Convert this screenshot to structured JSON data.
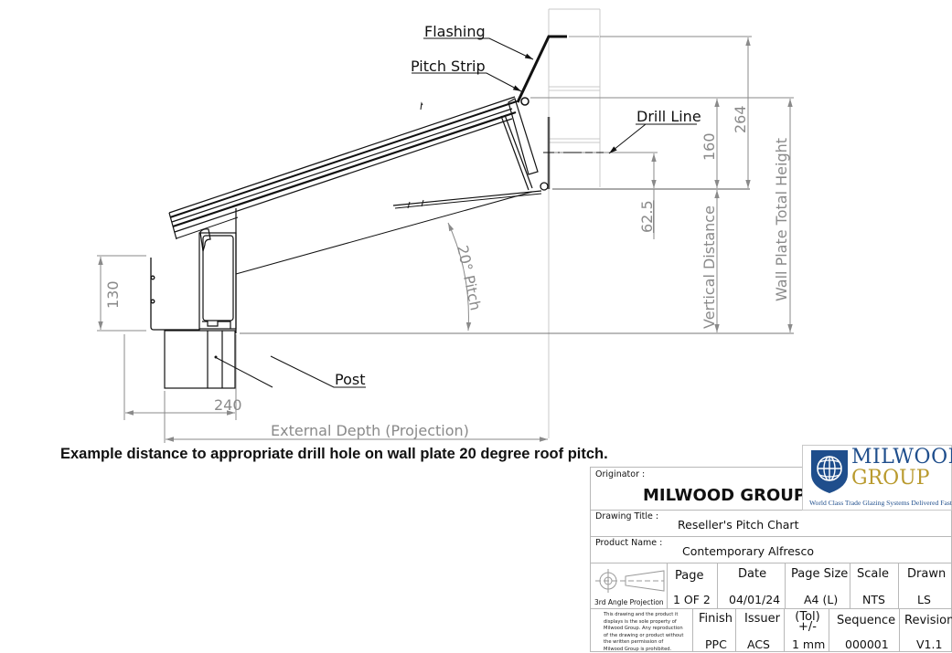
{
  "drawing": {
    "labels": {
      "flashing": "Flashing",
      "pitch_strip": "Pitch Strip",
      "drill_line": "Drill Line",
      "post": "Post",
      "pitch": "20° Pitch",
      "vertical_distance": "Vertical Distance",
      "wall_plate_total_height": "Wall Plate Total Height",
      "external_depth": "External Depth (Projection)"
    },
    "dimensions": {
      "gutter_height": "130",
      "post_width": "240",
      "drill_offset": "62.5",
      "wall_plate_upper": "160",
      "flashing_height": "264"
    },
    "caption": "Example distance to appropriate drill hole on wall plate 20 degree roof pitch."
  },
  "title_block": {
    "originator_label": "Originator :",
    "originator_value": "MILWOOD GROUP",
    "logo": {
      "line1": "MILWOOD",
      "line2": "GROUP",
      "tagline": "World Class Trade Glazing Systems Delivered Fast",
      "icon": "globe-shield-icon",
      "colors": {
        "blue": "#1f4e8c",
        "gold": "#b99a2e"
      }
    },
    "drawing_title_label": "Drawing Title :",
    "drawing_title_value": "Reseller's Pitch Chart",
    "product_name_label": "Product Name :",
    "product_name_value": "Contemporary Alfresco",
    "projection_label": "3rd Angle Projection",
    "row1": [
      {
        "header": "Page",
        "value": "1 OF 2"
      },
      {
        "header": "Date",
        "value": "04/01/24"
      },
      {
        "header": "Page Size",
        "value": "A4 (L)"
      },
      {
        "header": "Scale",
        "value": "NTS"
      },
      {
        "header": "Drawn",
        "value": "LS"
      }
    ],
    "disclaimer": "This drawing and the product it displays is the sole property of Milwood Group. Any reproduction of the drawing or product without the written permission of Milwood Group is prohibited.",
    "row2": [
      {
        "header": "Finish",
        "value": "PPC"
      },
      {
        "header": "Issuer",
        "value": "ACS"
      },
      {
        "header": "(Tol) +/-",
        "value": "1 mm"
      },
      {
        "header": "Sequence",
        "value": "000001"
      },
      {
        "header": "Revision",
        "value": "V1.1"
      }
    ]
  }
}
